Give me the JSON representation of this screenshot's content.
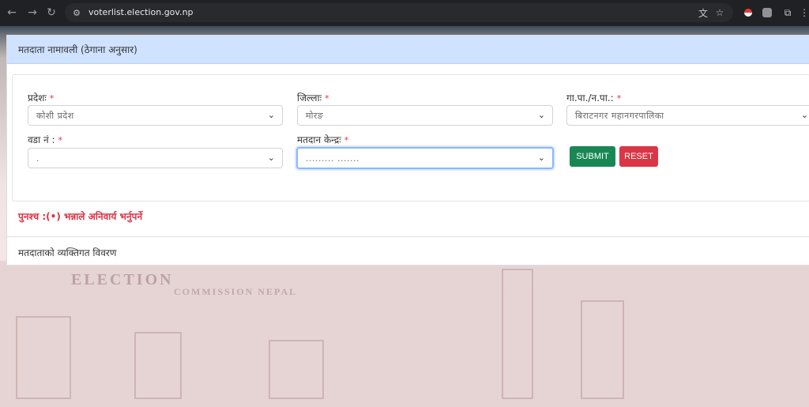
{
  "browser": {
    "url": "voterlist.election.gov.np"
  },
  "background": {
    "sign_text": "ELECTION",
    "sign_text2": "COMMISSION NEPAL"
  },
  "card": {
    "header": "मतदाता नामावली (ठेगाना अनुसार)"
  },
  "form": {
    "province": {
      "label": "प्रदेशः",
      "value": "कोशी प्रदेश"
    },
    "district": {
      "label": "जिल्लाः",
      "value": "मोरङ"
    },
    "municipality": {
      "label": "गा.पा./न.पा.:",
      "value": "बिराटनगर महानगरपालिका"
    },
    "ward": {
      "label": "वडा नं :",
      "value": "."
    },
    "center": {
      "label": "मतदान केन्द्रः",
      "value": "......... ......."
    },
    "required_mark": "*",
    "submit_label": "SUBMIT",
    "reset_label": "RESET"
  },
  "note": "पुनश्च :(•) भन्नाले अनिवार्य भर्नुपर्ने",
  "section_title": "मतदाताको व्यक्तिगत विवरण"
}
